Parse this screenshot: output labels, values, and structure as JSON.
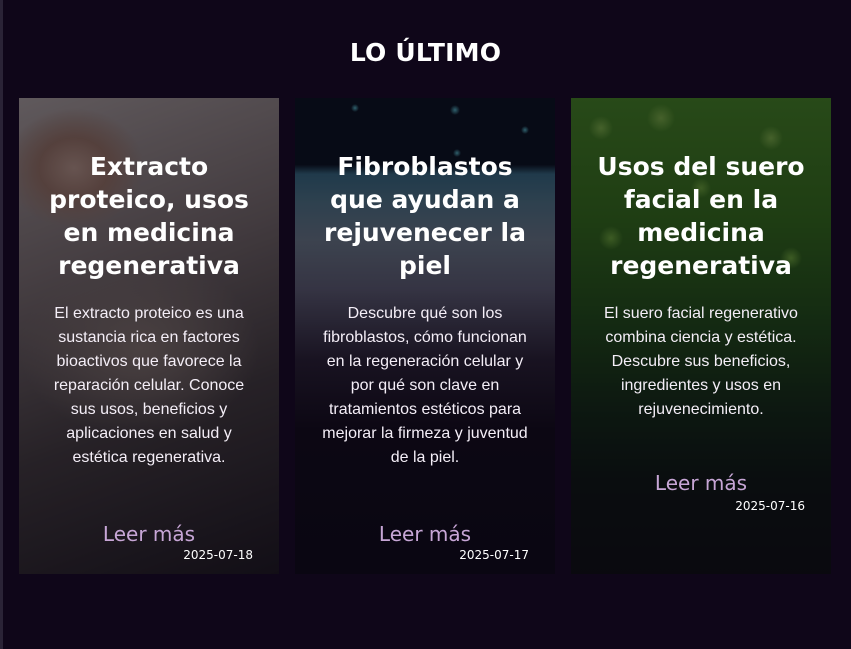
{
  "section": {
    "title": "LO ÚLTIMO"
  },
  "cards": [
    {
      "title": "Extracto proteico, usos en medicina regenerativa",
      "excerpt": "El extracto proteico es una sustancia rica en factores bioactivos que favorece la reparación celular. Conoce sus usos, beneficios y aplicaciones en salud y estética regenerativa.",
      "more_label": "Leer más",
      "date": "2025-07-18"
    },
    {
      "title": "Fibroblastos que ayudan a rejuvenecer la piel",
      "excerpt": "Descubre qué son los fibroblastos, cómo funcionan en la regeneración celular y por qué son clave en tratamientos estéticos para mejorar la firmeza y juventud de la piel.",
      "more_label": "Leer más",
      "date": "2025-07-17"
    },
    {
      "title": "Usos del suero facial en la medicina regenerativa",
      "excerpt": "El suero facial regenerativo combina ciencia y estética. Descubre sus beneficios, ingredientes y usos en rejuvenecimiento.",
      "more_label": "Leer más",
      "date": "2025-07-16"
    }
  ]
}
